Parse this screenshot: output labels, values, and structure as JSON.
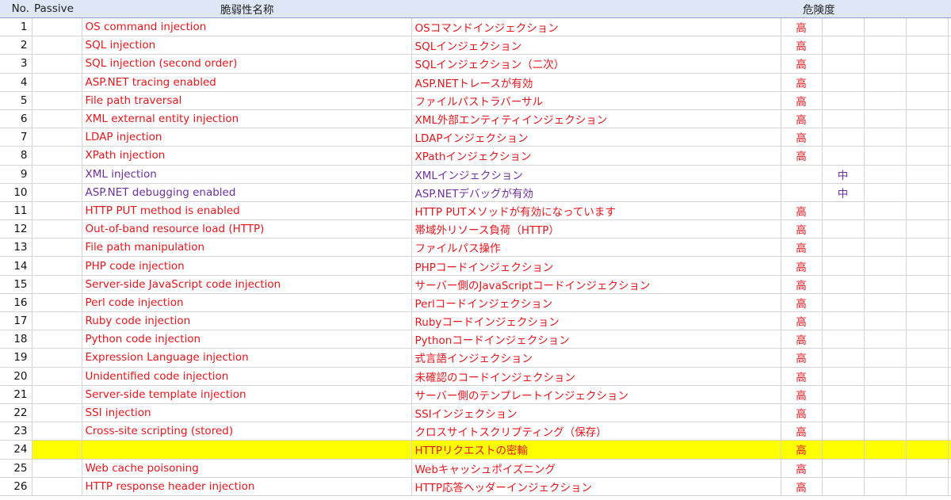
{
  "headers": {
    "no": "No.",
    "passive": "Passive",
    "name": "脆弱性名称",
    "risk": "危険度"
  },
  "colors": {
    "high_text": "#e8161c",
    "medium_text": "#7030a0",
    "header_bg": "#dde7f5",
    "highlight_bg": "#ffff00"
  },
  "rows": [
    {
      "no": "1",
      "en": "OS command injection",
      "ja": "OSコマンドインジェクション",
      "high": "高",
      "mid": ""
    },
    {
      "no": "2",
      "en": "SQL injection",
      "ja": "SQLインジェクション",
      "high": "高",
      "mid": ""
    },
    {
      "no": "3",
      "en": "SQL injection (second order)",
      "ja": "SQLインジェクション（二次）",
      "high": "高",
      "mid": ""
    },
    {
      "no": "4",
      "en": "ASP.NET tracing enabled",
      "ja": "ASP.NETトレースが有効",
      "high": "高",
      "mid": ""
    },
    {
      "no": "5",
      "en": "File path traversal",
      "ja": "ファイルパストラバーサル",
      "high": "高",
      "mid": ""
    },
    {
      "no": "6",
      "en": "XML external entity injection",
      "ja": "XML外部エンティティインジェクション",
      "high": "高",
      "mid": ""
    },
    {
      "no": "7",
      "en": "LDAP injection",
      "ja": "LDAPインジェクション",
      "high": "高",
      "mid": ""
    },
    {
      "no": "8",
      "en": "XPath injection",
      "ja": "XPathインジェクション",
      "high": "高",
      "mid": ""
    },
    {
      "no": "9",
      "en": "XML injection",
      "ja": "XMLインジェクション",
      "high": "",
      "mid": "中"
    },
    {
      "no": "10",
      "en": "ASP.NET debugging enabled",
      "ja": "ASP.NETデバッグが有効",
      "high": "",
      "mid": "中"
    },
    {
      "no": "11",
      "en": "HTTP PUT method is enabled",
      "ja": "HTTP PUTメソッドが有効になっています",
      "high": "高",
      "mid": ""
    },
    {
      "no": "12",
      "en": "Out-of-band resource load (HTTP)",
      "ja": "帯域外リソース負荷（HTTP）",
      "high": "高",
      "mid": ""
    },
    {
      "no": "13",
      "en": "File path manipulation",
      "ja": "ファイルパス操作",
      "high": "高",
      "mid": ""
    },
    {
      "no": "14",
      "en": "PHP code injection",
      "ja": "PHPコードインジェクション",
      "high": "高",
      "mid": ""
    },
    {
      "no": "15",
      "en": "Server-side JavaScript code injection",
      "ja": "サーバー側のJavaScriptコードインジェクション",
      "high": "高",
      "mid": ""
    },
    {
      "no": "16",
      "en": "Perl code injection",
      "ja": "Perlコードインジェクション",
      "high": "高",
      "mid": ""
    },
    {
      "no": "17",
      "en": "Ruby code injection",
      "ja": "Rubyコードインジェクション",
      "high": "高",
      "mid": ""
    },
    {
      "no": "18",
      "en": "Python code injection",
      "ja": "Pythonコードインジェクション",
      "high": "高",
      "mid": ""
    },
    {
      "no": "19",
      "en": "Expression Language injection",
      "ja": "式言語インジェクション",
      "high": "高",
      "mid": ""
    },
    {
      "no": "20",
      "en": "Unidentified code injection",
      "ja": "未確認のコードインジェクション",
      "high": "高",
      "mid": ""
    },
    {
      "no": "21",
      "en": "Server-side template injection",
      "ja": "サーバー側のテンプレートインジェクション",
      "high": "高",
      "mid": ""
    },
    {
      "no": "22",
      "en": "SSI injection",
      "ja": "SSIインジェクション",
      "high": "高",
      "mid": ""
    },
    {
      "no": "23",
      "en": "Cross-site scripting (stored)",
      "ja": "クロスサイトスクリプティング（保存）",
      "high": "高",
      "mid": ""
    },
    {
      "no": "24",
      "en": "",
      "ja": "HTTPリクエストの密輸",
      "high": "高",
      "mid": "",
      "highlight": true
    },
    {
      "no": "25",
      "en": "Web cache poisoning",
      "ja": "Webキャッシュポイズニング",
      "high": "高",
      "mid": ""
    },
    {
      "no": "26",
      "en": "HTTP response header injection",
      "ja": "HTTP応答ヘッダーインジェクション",
      "high": "高",
      "mid": ""
    }
  ]
}
